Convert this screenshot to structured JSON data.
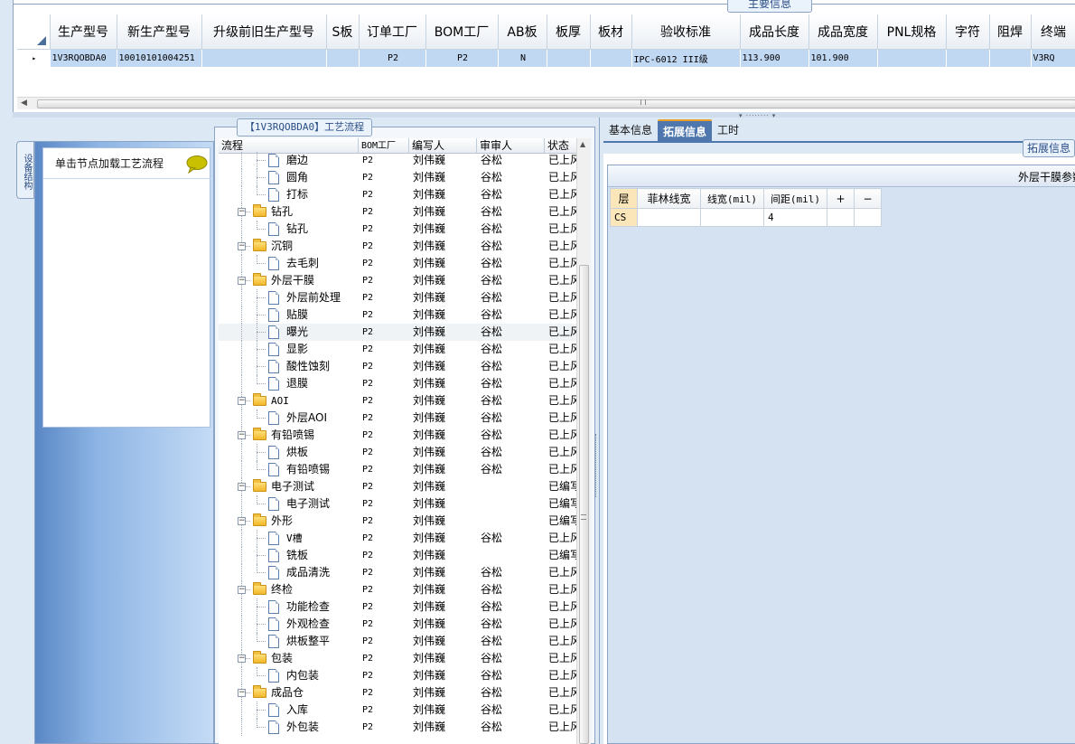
{
  "main": {
    "section_title": "主要信息",
    "columns": [
      "生产型号",
      "新生产型号",
      "升级前旧生产型号",
      "S板",
      "订单工厂",
      "BOM工厂",
      "AB板",
      "板厚",
      "板材",
      "验收标准",
      "成品长度",
      "成品宽度",
      "PNL规格",
      "字符",
      "阻焊",
      "终端"
    ],
    "row": {
      "indicator": "▸",
      "cells": [
        "1V3RQOBDA0",
        "10010101004251",
        "",
        "",
        "P2",
        "P2",
        "N",
        "",
        "",
        "IPC-6012 III级",
        "113.900",
        "101.900",
        "",
        "",
        "",
        "V3RQ"
      ]
    }
  },
  "sidebar": {
    "tab_label": "设备结构",
    "note": "单击节点加载工艺流程"
  },
  "process": {
    "title": "【1V3RQOBDA0】工艺流程",
    "headers": [
      "流程",
      "BOM工厂",
      "编写人",
      "审审人",
      "状态"
    ],
    "rows": [
      {
        "level": 2,
        "type": "doc",
        "name": "磨边",
        "bom": "P2",
        "writer": "刘伟巍",
        "reviewer": "谷松",
        "status": "已上风"
      },
      {
        "level": 2,
        "type": "doc",
        "name": "圆角",
        "bom": "P2",
        "writer": "刘伟巍",
        "reviewer": "谷松",
        "status": "已上风"
      },
      {
        "level": 2,
        "type": "doc",
        "name": "打标",
        "bom": "P2",
        "writer": "刘伟巍",
        "reviewer": "谷松",
        "status": "已上风"
      },
      {
        "level": 1,
        "type": "folder",
        "name": "钻孔",
        "bom": "P2",
        "writer": "刘伟巍",
        "reviewer": "谷松",
        "status": "已上风"
      },
      {
        "level": 2,
        "type": "doc",
        "name": "钻孔",
        "bom": "P2",
        "writer": "刘伟巍",
        "reviewer": "谷松",
        "status": "已上风"
      },
      {
        "level": 1,
        "type": "folder",
        "name": "沉铜",
        "bom": "P2",
        "writer": "刘伟巍",
        "reviewer": "谷松",
        "status": "已上风"
      },
      {
        "level": 2,
        "type": "doc",
        "name": "去毛刺",
        "bom": "P2",
        "writer": "刘伟巍",
        "reviewer": "谷松",
        "status": "已上风"
      },
      {
        "level": 1,
        "type": "folder",
        "name": "外层干膜",
        "bom": "P2",
        "writer": "刘伟巍",
        "reviewer": "谷松",
        "status": "已上风"
      },
      {
        "level": 2,
        "type": "doc",
        "name": "外层前处理",
        "bom": "P2",
        "writer": "刘伟巍",
        "reviewer": "谷松",
        "status": "已上风"
      },
      {
        "level": 2,
        "type": "doc",
        "name": "贴膜",
        "bom": "P2",
        "writer": "刘伟巍",
        "reviewer": "谷松",
        "status": "已上风"
      },
      {
        "level": 2,
        "type": "doc",
        "name": "曝光",
        "bom": "P2",
        "writer": "刘伟巍",
        "reviewer": "谷松",
        "status": "已上风",
        "selected": true
      },
      {
        "level": 2,
        "type": "doc",
        "name": "显影",
        "bom": "P2",
        "writer": "刘伟巍",
        "reviewer": "谷松",
        "status": "已上风"
      },
      {
        "level": 2,
        "type": "doc",
        "name": "酸性蚀刻",
        "bom": "P2",
        "writer": "刘伟巍",
        "reviewer": "谷松",
        "status": "已上风"
      },
      {
        "level": 2,
        "type": "doc",
        "name": "退膜",
        "bom": "P2",
        "writer": "刘伟巍",
        "reviewer": "谷松",
        "status": "已上风"
      },
      {
        "level": 1,
        "type": "folder",
        "name": "AOI",
        "bom": "P2",
        "writer": "刘伟巍",
        "reviewer": "谷松",
        "status": "已上风"
      },
      {
        "level": 2,
        "type": "doc",
        "name": "外层AOI",
        "bom": "P2",
        "writer": "刘伟巍",
        "reviewer": "谷松",
        "status": "已上风"
      },
      {
        "level": 1,
        "type": "folder",
        "name": "有铅喷锡",
        "bom": "P2",
        "writer": "刘伟巍",
        "reviewer": "谷松",
        "status": "已上风"
      },
      {
        "level": 2,
        "type": "doc",
        "name": "烘板",
        "bom": "P2",
        "writer": "刘伟巍",
        "reviewer": "谷松",
        "status": "已上风"
      },
      {
        "level": 2,
        "type": "doc",
        "name": "有铅喷锡",
        "bom": "P2",
        "writer": "刘伟巍",
        "reviewer": "谷松",
        "status": "已上风"
      },
      {
        "level": 1,
        "type": "folder",
        "name": "电子测试",
        "bom": "P2",
        "writer": "刘伟巍",
        "reviewer": "",
        "status": "已编写"
      },
      {
        "level": 2,
        "type": "doc",
        "name": "电子测试",
        "bom": "P2",
        "writer": "刘伟巍",
        "reviewer": "",
        "status": "已编写"
      },
      {
        "level": 1,
        "type": "folder",
        "name": "外形",
        "bom": "P2",
        "writer": "刘伟巍",
        "reviewer": "",
        "status": "已编写"
      },
      {
        "level": 2,
        "type": "doc",
        "name": "V槽",
        "bom": "P2",
        "writer": "刘伟巍",
        "reviewer": "谷松",
        "status": "已上风"
      },
      {
        "level": 2,
        "type": "doc",
        "name": "铣板",
        "bom": "P2",
        "writer": "刘伟巍",
        "reviewer": "",
        "status": "已编写"
      },
      {
        "level": 2,
        "type": "doc",
        "name": "成品清洗",
        "bom": "P2",
        "writer": "刘伟巍",
        "reviewer": "谷松",
        "status": "已上风"
      },
      {
        "level": 1,
        "type": "folder",
        "name": "终检",
        "bom": "P2",
        "writer": "刘伟巍",
        "reviewer": "谷松",
        "status": "已上风"
      },
      {
        "level": 2,
        "type": "doc",
        "name": "功能检查",
        "bom": "P2",
        "writer": "刘伟巍",
        "reviewer": "谷松",
        "status": "已上风"
      },
      {
        "level": 2,
        "type": "doc",
        "name": "外观检查",
        "bom": "P2",
        "writer": "刘伟巍",
        "reviewer": "谷松",
        "status": "已上风"
      },
      {
        "level": 2,
        "type": "doc",
        "name": "烘板整平",
        "bom": "P2",
        "writer": "刘伟巍",
        "reviewer": "谷松",
        "status": "已上风"
      },
      {
        "level": 1,
        "type": "folder",
        "name": "包装",
        "bom": "P2",
        "writer": "刘伟巍",
        "reviewer": "谷松",
        "status": "已上风"
      },
      {
        "level": 2,
        "type": "doc",
        "name": "内包装",
        "bom": "P2",
        "writer": "刘伟巍",
        "reviewer": "谷松",
        "status": "已上风"
      },
      {
        "level": 1,
        "type": "folder",
        "name": "成品仓",
        "bom": "P2",
        "writer": "刘伟巍",
        "reviewer": "谷松",
        "status": "已上风"
      },
      {
        "level": 2,
        "type": "doc",
        "name": "入库",
        "bom": "P2",
        "writer": "刘伟巍",
        "reviewer": "谷松",
        "status": "已上风"
      },
      {
        "level": 2,
        "type": "doc",
        "name": "外包装",
        "bom": "P2",
        "writer": "刘伟巍",
        "reviewer": "谷松",
        "status": "已上风"
      }
    ]
  },
  "right": {
    "tabs": [
      "基本信息",
      "拓展信息",
      "工时"
    ],
    "active_tab": 1,
    "ext_tab_label": "拓展信息",
    "panel_title": "外层干膜参数",
    "param_headers": [
      "层",
      "菲林线宽",
      "线宽(mil)",
      "间距(mil)",
      "+",
      "−"
    ],
    "param_rows": [
      [
        "CS",
        "",
        "",
        "4",
        "",
        ""
      ]
    ]
  },
  "colors": {
    "grid_selected_row": "#c1d8f3",
    "active_tab": "#4f77ae",
    "layer_cell": "#fbe6b9",
    "sidebar_gradient_start": "#5a88c6"
  }
}
